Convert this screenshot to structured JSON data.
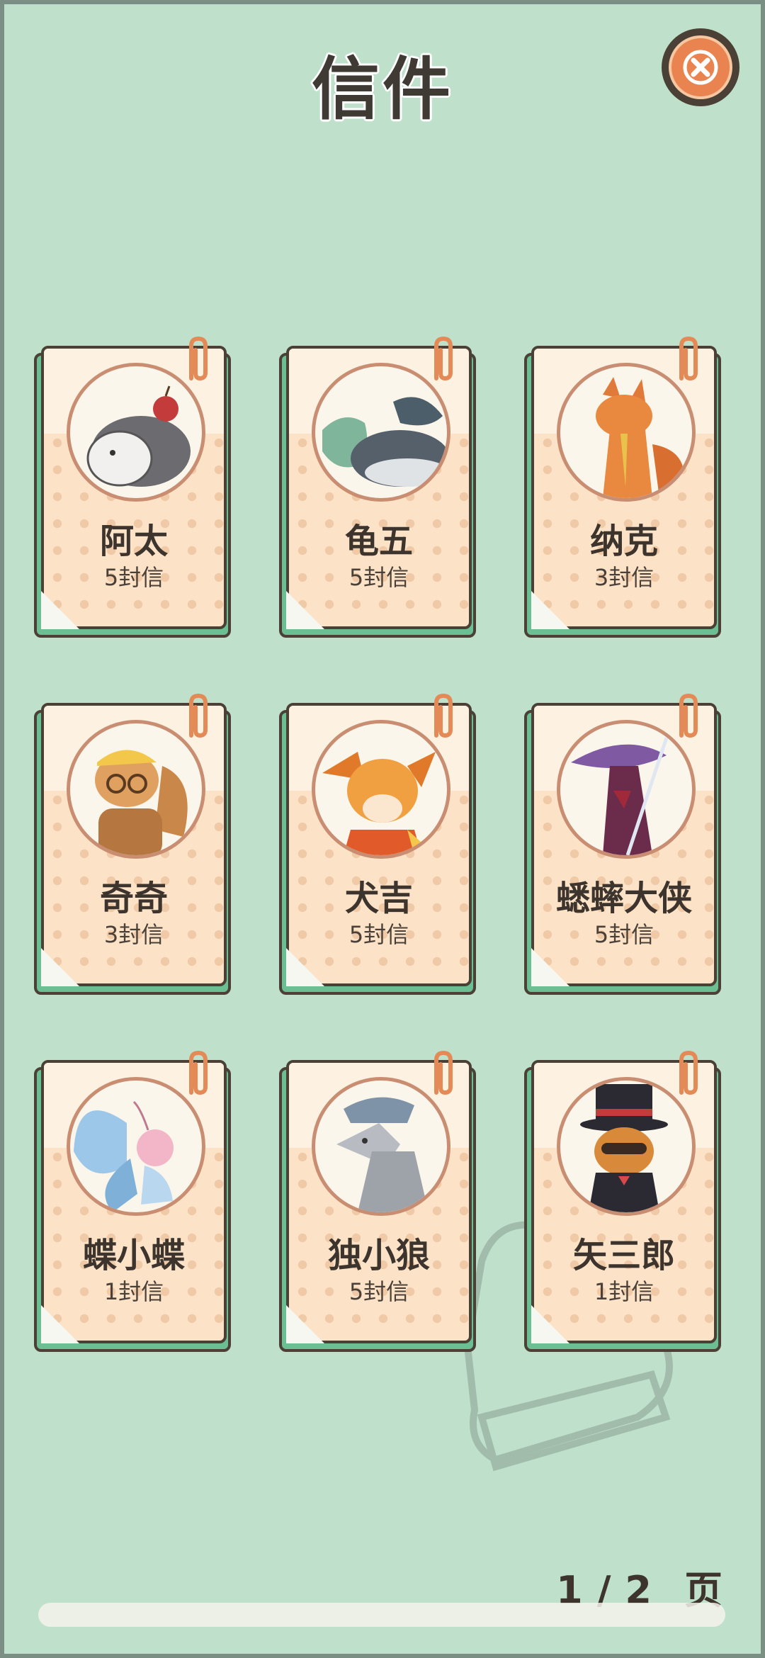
{
  "header": {
    "title": "信件"
  },
  "letters": [
    {
      "name": "阿太",
      "count": "5封信",
      "avatar_icon": "hedgehog-icon"
    },
    {
      "name": "龟五",
      "count": "5封信",
      "avatar_icon": "turtle-icon"
    },
    {
      "name": "纳克",
      "count": "3封信",
      "avatar_icon": "fox-icon"
    },
    {
      "name": "奇奇",
      "count": "3封信",
      "avatar_icon": "squirrel-icon"
    },
    {
      "name": "犬吉",
      "count": "5封信",
      "avatar_icon": "dog-icon"
    },
    {
      "name": "蟋蟀大侠",
      "count": "5封信",
      "avatar_icon": "cricket-swordsman-icon"
    },
    {
      "name": "蝶小蝶",
      "count": "1封信",
      "avatar_icon": "butterfly-icon"
    },
    {
      "name": "独小狼",
      "count": "5封信",
      "avatar_icon": "wolf-icon"
    },
    {
      "name": "矢三郎",
      "count": "1封信",
      "avatar_icon": "raccoon-tophat-icon"
    }
  ],
  "pager": {
    "current": "1",
    "separator": "/",
    "total": "2",
    "unit": "页"
  },
  "colors": {
    "background": "#bfe1cc",
    "card_paper": "#fce3c8",
    "card_back": "#6cbf92",
    "close_button": "#e9834f",
    "outline": "#4b4036"
  }
}
